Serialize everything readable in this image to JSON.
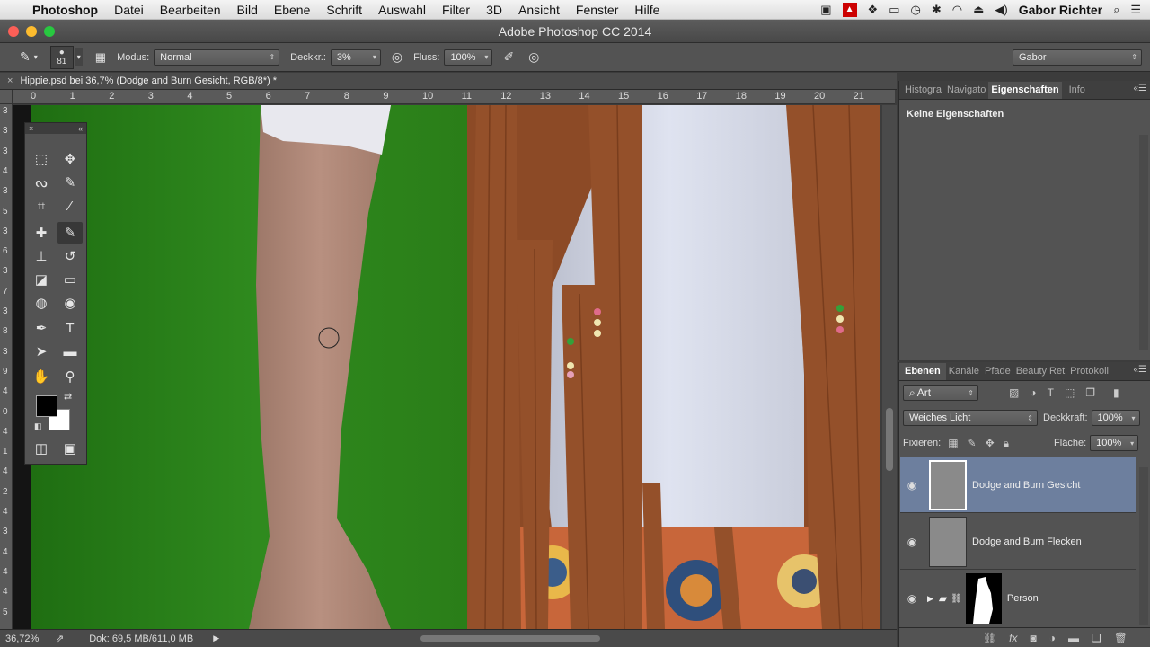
{
  "menubar": {
    "apple_icon": "apple-logo",
    "app": "Photoshop",
    "items": [
      "Datei",
      "Bearbeiten",
      "Bild",
      "Ebene",
      "Schrift",
      "Auswahl",
      "Filter",
      "3D",
      "Ansicht",
      "Fenster",
      "Hilfe"
    ],
    "user": "Gabor Richter"
  },
  "window": {
    "title": "Adobe Photoshop CC 2014"
  },
  "options": {
    "brush_size": "81",
    "mode_label": "Modus:",
    "mode_value": "Normal",
    "opacity_label": "Deckkr.:",
    "opacity_value": "3%",
    "flow_label": "Fluss:",
    "flow_value": "100%",
    "workspace": "Gabor"
  },
  "document": {
    "tab_title": "Hippie.psd bei 36,7% (Dodge and Burn Gesicht, RGB/8*) *"
  },
  "ruler": {
    "top": [
      "0",
      "1",
      "2",
      "3",
      "4",
      "5",
      "6",
      "7",
      "8",
      "9",
      "10",
      "11",
      "12",
      "13",
      "14",
      "15",
      "16",
      "17",
      "18",
      "19",
      "20",
      "21"
    ],
    "left": [
      "3",
      "3",
      "3",
      "4",
      "3",
      "5",
      "3",
      "6",
      "3",
      "7",
      "3",
      "8",
      "3",
      "9",
      "4",
      "0",
      "4",
      "1",
      "4",
      "2",
      "4",
      "3",
      "4",
      "4",
      "4",
      "5"
    ]
  },
  "status": {
    "zoom": "36,72%",
    "doc_info": "Dok: 69,5 MB/611,0 MB"
  },
  "properties_panel": {
    "tabs": [
      "Histogra",
      "Navigato",
      "Eigenschaften",
      "Info"
    ],
    "active_tab": "Eigenschaften",
    "content": "Keine Eigenschaften"
  },
  "layers_panel": {
    "tabs": [
      "Ebenen",
      "Kanäle",
      "Pfade",
      "Beauty Ret",
      "Protokoll"
    ],
    "active_tab": "Ebenen",
    "filter_kind": "Art",
    "blend_mode": "Weiches Licht",
    "opacity_label": "Deckkraft:",
    "opacity_value": "100%",
    "lock_label": "Fixieren:",
    "fill_label": "Fläche:",
    "fill_value": "100%",
    "layers": [
      {
        "name": "Dodge and Burn Gesicht",
        "selected": true
      },
      {
        "name": "Dodge and Burn Flecken",
        "selected": false
      },
      {
        "name": "Person",
        "selected": false
      }
    ]
  },
  "colors": {
    "foreground": "#000000",
    "background": "#ffffff",
    "green_screen": "#2f8a1e",
    "selection": "#6d7f9e"
  }
}
